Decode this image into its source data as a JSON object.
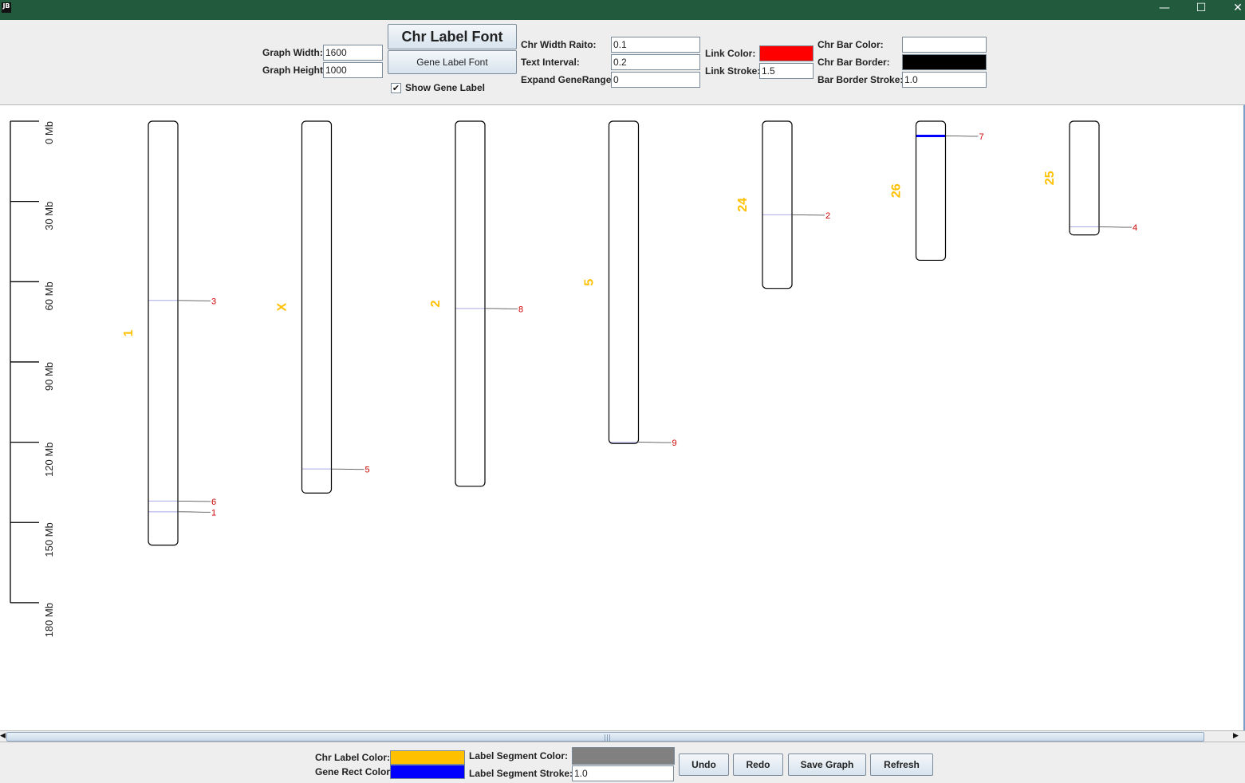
{
  "window": {
    "app_icon": "JB",
    "controls": {
      "minimize": "—",
      "maximize": "☐",
      "close": "✕"
    }
  },
  "top_controls": {
    "graph_width_label": "Graph Width:",
    "graph_width_value": "1600",
    "graph_height_label": "Graph Height:",
    "graph_height_value": "1000",
    "chr_label_font_button": "Chr Label Font",
    "gene_label_font_button": "Gene Label Font",
    "show_gene_label": {
      "label": "Show Gene Label",
      "checked": true,
      "mark": "✔"
    },
    "chr_width_ratio_label": "Chr Width Raito:",
    "chr_width_ratio_value": "0.1",
    "text_interval_label": "Text Interval:",
    "text_interval_value": "0.2",
    "expand_gene_range_label": "Expand GeneRange:",
    "expand_gene_range_value": "0",
    "link_color_label": "Link Color:",
    "link_color": "#ff0000",
    "link_stroke_label": "Link Stroke:",
    "link_stroke_value": "1.5",
    "chr_bar_color_label": "Chr Bar Color:",
    "chr_bar_color": "#ffffff",
    "chr_bar_border_label": "Chr Bar Border:",
    "chr_bar_border_color": "#000000",
    "bar_border_stroke_label": "Bar Border Stroke:",
    "bar_border_stroke_value": "1.0"
  },
  "bottom_controls": {
    "chr_label_color_label": "Chr Label Color:",
    "chr_label_color": "#ffc000",
    "gene_rect_color_label": "Gene Rect Color:",
    "gene_rect_color": "#0000ff",
    "label_segment_color_label": "Label Segment Color:",
    "label_segment_color": "#808080",
    "label_segment_stroke_label": "Label Segment Stroke:",
    "label_segment_stroke_value": "1.0",
    "undo_button": "Undo",
    "redo_button": "Redo",
    "save_graph_button": "Save Graph",
    "refresh_button": "Refresh"
  },
  "scrollbar": {
    "grip": "|||",
    "left_arrow": "◀",
    "right_arrow": "▶"
  },
  "chart_data": {
    "type": "chromosome-ideogram",
    "scale_unit": "Mb",
    "scale_ticks": [
      "0 Mb",
      "30 Mb",
      "60 Mb",
      "90 Mb",
      "120 Mb",
      "150 Mb",
      "180 Mb"
    ],
    "scale_range": [
      0,
      180
    ],
    "chromosomes": [
      {
        "name": "1",
        "length_mb": 158.5,
        "genes": [
          {
            "label": "3",
            "pos_mb": 67.0
          },
          {
            "label": "6",
            "pos_mb": 142.0
          },
          {
            "label": "1",
            "pos_mb": 146.0
          }
        ]
      },
      {
        "name": "X",
        "length_mb": 139.0,
        "genes": [
          {
            "label": "5",
            "pos_mb": 130.0
          }
        ]
      },
      {
        "name": "2",
        "length_mb": 136.5,
        "genes": [
          {
            "label": "8",
            "pos_mb": 70.0
          }
        ]
      },
      {
        "name": "5",
        "length_mb": 120.5,
        "genes": [
          {
            "label": "9",
            "pos_mb": 120.0
          }
        ]
      },
      {
        "name": "24",
        "length_mb": 62.5,
        "genes": [
          {
            "label": "2",
            "pos_mb": 35.0
          }
        ]
      },
      {
        "name": "26",
        "length_mb": 52.0,
        "genes": [
          {
            "label": "7",
            "pos_mb": 5.5,
            "highlight": true
          }
        ]
      },
      {
        "name": "25",
        "length_mb": 42.5,
        "genes": [
          {
            "label": "4",
            "pos_mb": 39.5
          }
        ]
      }
    ]
  }
}
